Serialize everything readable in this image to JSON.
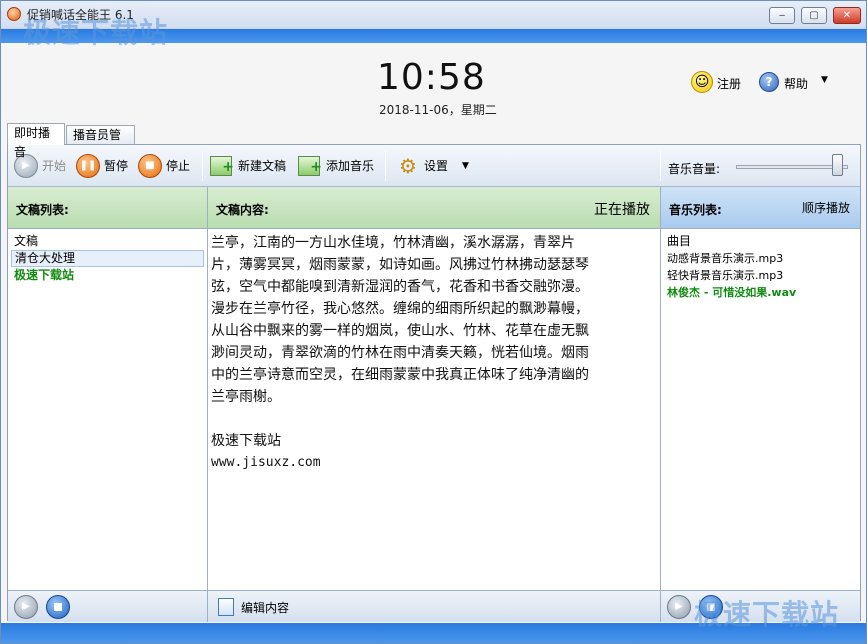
{
  "window": {
    "title": "促销喊话全能王 6.1",
    "minimize": "‒",
    "maximize": "▢",
    "close": "✕"
  },
  "watermark": {
    "text": "极速下载站"
  },
  "header": {
    "time": "10:58",
    "date": "2018-11-06，星期二",
    "register_label": "注册",
    "help_label": "帮助",
    "help_glyph": "?",
    "smile_glyph": "☺",
    "caret_glyph": "▼"
  },
  "tabs": [
    {
      "label": "即时播音"
    },
    {
      "label": "播音员管理"
    }
  ],
  "toolbar": {
    "start_label": "开始",
    "pause_label": "暂停",
    "stop_label": "停止",
    "new_doc_label": "新建文稿",
    "add_music_label": "添加音乐",
    "settings_label": "设置",
    "volume_label": "音乐音量:",
    "volume_level": 0.95
  },
  "doc_list": {
    "header": "文稿列表:",
    "column": "文稿",
    "items": [
      {
        "label": "清仓大处理",
        "state": "selected"
      },
      {
        "label": "极速下载站",
        "state": "active"
      }
    ]
  },
  "doc_content": {
    "header": "文稿内容:",
    "status": "正在播放",
    "lines": [
      "兰亭，江南的一方山水佳境，竹林清幽，溪水潺潺，青翠片",
      "片，薄雾冥冥，烟雨蒙蒙，如诗如画。风拂过竹林拂动瑟瑟琴",
      "弦，空气中都能嗅到清新湿润的香气，花香和书香交融弥漫。",
      "漫步在兰亭竹径，我心悠然。缠绵的细雨所织起的飘渺幕幔，",
      "从山谷中飘来的雾一样的烟岚，使山水、竹林、花草在虚无飘",
      "渺间灵动，青翠欲滴的竹林在雨中清奏天籁，恍若仙境。烟雨",
      "中的兰亭诗意而空灵，在细雨蒙蒙中我真正体味了纯净清幽的",
      "兰亭雨榭。"
    ],
    "site_name": "极速下载站",
    "site_url": "www.jisuxz.com",
    "edit_label": "编辑内容"
  },
  "music_list": {
    "header": "音乐列表:",
    "mode": "顺序播放",
    "column": "曲目",
    "items": [
      {
        "label": "动感背景音乐演示.mp3",
        "state": "normal"
      },
      {
        "label": "轻快背景音乐演示.mp3",
        "state": "normal"
      },
      {
        "label": "林俊杰 - 可惜没如果.wav",
        "state": "active"
      }
    ]
  },
  "glyphs": {
    "play": "▶",
    "pause": "❚❚",
    "stop": "■",
    "gear": "⚙"
  }
}
